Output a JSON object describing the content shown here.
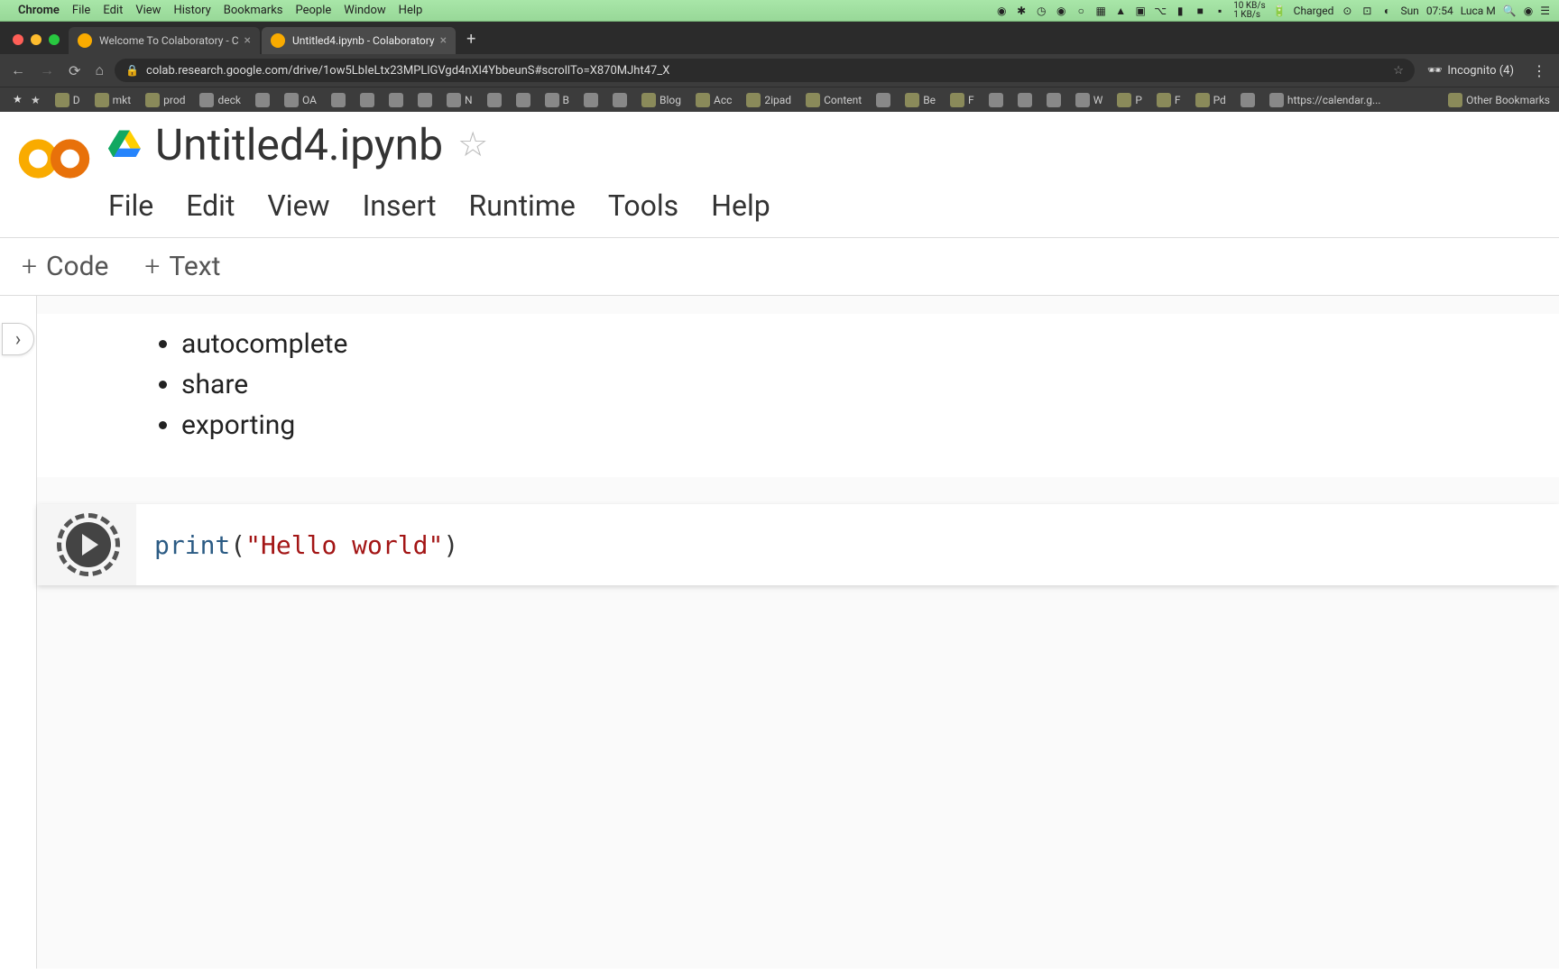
{
  "mac_menu": {
    "app": "Chrome",
    "items": [
      "File",
      "Edit",
      "View",
      "History",
      "Bookmarks",
      "People",
      "Window",
      "Help"
    ],
    "battery": "Charged",
    "net_down": "10 KB/s",
    "net_up": "1 KB/s",
    "day": "Sun",
    "time": "07:54",
    "user": "Luca M"
  },
  "browser": {
    "tabs": [
      {
        "title": "Welcome To Colaboratory - C",
        "active": false
      },
      {
        "title": "Untitled4.ipynb - Colaboratory",
        "active": true
      }
    ],
    "url": "colab.research.google.com/drive/1ow5LbIeLtx23MPLlGVgd4nXl4YbbeunS#scrollTo=X870MJht47_X",
    "incognito_label": "Incognito (4)",
    "bookmarks": [
      {
        "t": "★",
        "k": "star"
      },
      {
        "t": "D",
        "k": "folder"
      },
      {
        "t": "mkt",
        "k": "folder"
      },
      {
        "t": "prod",
        "k": "folder"
      },
      {
        "t": "deck",
        "k": "icon"
      },
      {
        "t": "",
        "k": "icon"
      },
      {
        "t": "OA",
        "k": "icon"
      },
      {
        "t": "",
        "k": "icon"
      },
      {
        "t": "",
        "k": "icon"
      },
      {
        "t": "",
        "k": "icon"
      },
      {
        "t": "",
        "k": "icon"
      },
      {
        "t": "N",
        "k": "icon"
      },
      {
        "t": "",
        "k": "icon"
      },
      {
        "t": "",
        "k": "icon"
      },
      {
        "t": "B",
        "k": "icon"
      },
      {
        "t": "",
        "k": "icon"
      },
      {
        "t": "",
        "k": "icon"
      },
      {
        "t": "Blog",
        "k": "folder"
      },
      {
        "t": "Acc",
        "k": "folder"
      },
      {
        "t": "2ipad",
        "k": "folder"
      },
      {
        "t": "Content",
        "k": "folder"
      },
      {
        "t": "",
        "k": "icon"
      },
      {
        "t": "Be",
        "k": "folder"
      },
      {
        "t": "F",
        "k": "folder"
      },
      {
        "t": "",
        "k": "icon"
      },
      {
        "t": "",
        "k": "icon"
      },
      {
        "t": "",
        "k": "icon"
      },
      {
        "t": "W",
        "k": "icon"
      },
      {
        "t": "P",
        "k": "folder"
      },
      {
        "t": "F",
        "k": "folder"
      },
      {
        "t": "Pd",
        "k": "folder"
      },
      {
        "t": "",
        "k": "icon"
      },
      {
        "t": "https://calendar.g...",
        "k": "link"
      }
    ],
    "other_bookmarks": "Other Bookmarks"
  },
  "colab": {
    "title": "Untitled4.ipynb",
    "menu": [
      "File",
      "Edit",
      "View",
      "Insert",
      "Runtime",
      "Tools",
      "Help"
    ],
    "toolbar": {
      "code": "Code",
      "text": "Text"
    },
    "text_cell_items": [
      "autocomplete",
      "share",
      "exporting"
    ],
    "code": {
      "keyword": "print",
      "paren_open": " (",
      "string": "\"Hello world\"",
      "paren_close": ")"
    }
  }
}
